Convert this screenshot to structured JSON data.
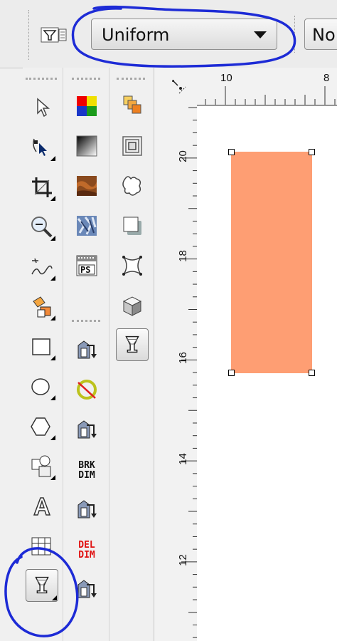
{
  "property_bar": {
    "fill_type_value": "Uniform",
    "next_field_value": "No"
  },
  "toolbox": {
    "tools": [
      {
        "name": "pick-tool"
      },
      {
        "name": "shape-tool"
      },
      {
        "name": "crop-tool"
      },
      {
        "name": "zoom-tool"
      },
      {
        "name": "freehand-tool"
      },
      {
        "name": "smart-fill-tool"
      },
      {
        "name": "rectangle-tool"
      },
      {
        "name": "ellipse-tool"
      },
      {
        "name": "polygon-tool"
      },
      {
        "name": "basic-shapes-tool"
      },
      {
        "name": "text-tool"
      },
      {
        "name": "table-tool"
      },
      {
        "name": "interactive-fill-tool",
        "active": true
      }
    ]
  },
  "macros_toolbar": {
    "dimension_labels": {
      "break_dim_line1": "BRK",
      "break_dim_line2": "DIM",
      "delete_dim_line1": "DEL",
      "delete_dim_line2": "DIM"
    }
  },
  "effects_flyout": {
    "tools": [
      "blend",
      "contour",
      "distort",
      "drop-shadow",
      "envelope",
      "extrude",
      "transparency"
    ],
    "active": "transparency"
  },
  "rulers": {
    "horizontal_labels": [
      "10",
      "8"
    ],
    "vertical_labels": [
      "20",
      "18",
      "16",
      "14",
      "12"
    ]
  },
  "canvas": {
    "rectangle_color": "#fe9e73",
    "annotation_color": "#1d2bd6"
  }
}
